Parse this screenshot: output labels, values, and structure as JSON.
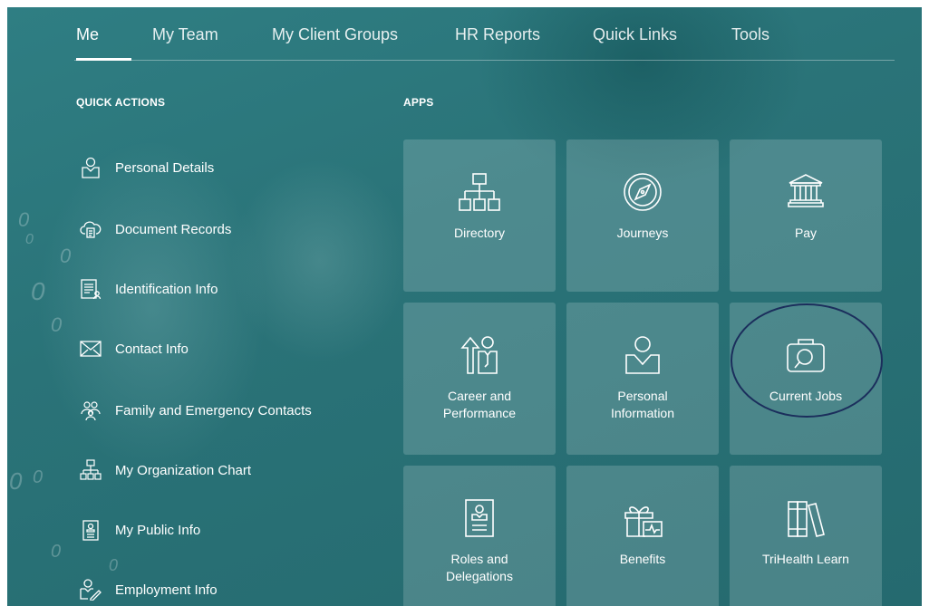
{
  "nav": {
    "tabs": [
      {
        "label": "Me",
        "active": true
      },
      {
        "label": "My Team"
      },
      {
        "label": "My Client Groups"
      },
      {
        "label": "HR Reports"
      },
      {
        "label": "Quick Links"
      },
      {
        "label": "Tools"
      }
    ]
  },
  "quick_actions": {
    "title": "QUICK ACTIONS",
    "items": [
      {
        "label": "Personal Details",
        "icon": "person-badge-icon"
      },
      {
        "label": "Document Records",
        "icon": "cloud-document-icon"
      },
      {
        "label": "Identification Info",
        "icon": "id-card-icon"
      },
      {
        "label": "Contact Info",
        "icon": "envelope-icon"
      },
      {
        "label": "Family and Emergency Contacts",
        "icon": "family-icon"
      },
      {
        "label": "My Organization Chart",
        "icon": "org-chart-icon"
      },
      {
        "label": "My Public Info",
        "icon": "badge-card-icon"
      },
      {
        "label": "Employment Info",
        "icon": "person-pen-icon"
      }
    ]
  },
  "apps": {
    "title": "APPS",
    "tiles": [
      {
        "label": "Directory",
        "icon": "org-chart-icon"
      },
      {
        "label": "Journeys",
        "icon": "compass-icon"
      },
      {
        "label": "Pay",
        "icon": "bank-icon"
      },
      {
        "label": "Career and\nPerformance",
        "icon": "career-arrow-person-icon"
      },
      {
        "label": "Personal\nInformation",
        "icon": "person-badge-icon"
      },
      {
        "label": "Current Jobs",
        "icon": "briefcase-search-icon"
      },
      {
        "label": "Roles and\nDelegations",
        "icon": "id-badge-icon"
      },
      {
        "label": "Benefits",
        "icon": "gift-pulse-icon"
      },
      {
        "label": "TriHealth Learn",
        "icon": "books-icon"
      }
    ]
  },
  "colors": {
    "background": "#2a7378",
    "tile": "rgba(255,255,255,0.17)",
    "highlight_ring": "#1b2e5c",
    "text": "#ffffff"
  }
}
